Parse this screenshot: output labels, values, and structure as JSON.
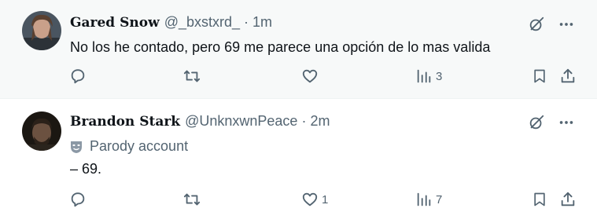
{
  "tweets": [
    {
      "display_name": "Gared Snow",
      "handle": "@_bxstxrd_",
      "separator": "·",
      "time": "1m",
      "parody_label": "",
      "text": "No los he contado, pero 69 me parece una opción de lo mas valida",
      "likes": "",
      "views": "3"
    },
    {
      "display_name": "Brandon Stark",
      "handle": "@UnknxwnPeace",
      "separator": "·",
      "time": "2m",
      "parody_label": "Parody account",
      "text": "– 69.",
      "likes": "1",
      "views": "7"
    }
  ],
  "icons": {
    "grok": "grok-icon",
    "more": "more-icon",
    "reply": "reply-icon",
    "retweet": "retweet-icon",
    "like": "like-icon",
    "views": "views-icon",
    "bookmark": "bookmark-icon",
    "share": "share-icon",
    "parody": "parody-mask-icon"
  },
  "colors": {
    "text": "#0f1419",
    "muted": "#536471",
    "highlight_bg": "#f7f9f9"
  }
}
